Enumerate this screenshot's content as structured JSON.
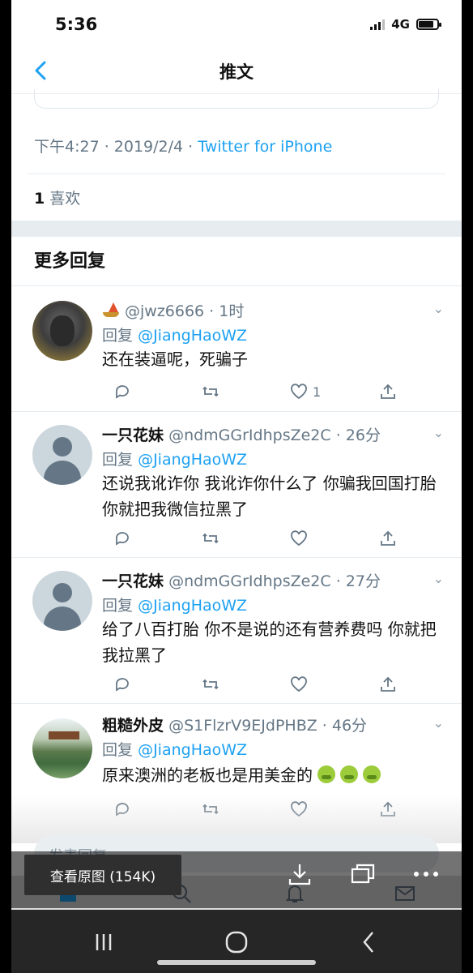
{
  "status_bar": {
    "time": "5:36",
    "network": "4G"
  },
  "nav": {
    "title": "推文"
  },
  "tweet": {
    "meta_prefix": "下午4:27 · 2019/2/4 · ",
    "source": "Twitter for iPhone",
    "likes_count": "1",
    "likes_label": "喜欢"
  },
  "section_title": "更多回复",
  "reply_prefix": "回复",
  "replies": [
    {
      "name": "",
      "handle": "@jwz6666 · 1时",
      "mention": "@JiangHaoWZ",
      "text": "还在装逼呢，死骗子",
      "like_count": "1"
    },
    {
      "name": "一只花妹",
      "handle": "@ndmGGrIdhpsZe2C · 26分",
      "mention": "@JiangHaoWZ",
      "text": "还说我讹诈你 我讹诈你什么了 你骗我回国打胎 你就把我微信拉黑了",
      "like_count": ""
    },
    {
      "name": "一只花妹",
      "handle": "@ndmGGrIdhpsZe2C · 27分",
      "mention": "@JiangHaoWZ",
      "text": "给了八百打胎 你不是说的还有营养费吗 你就把我拉黑了",
      "like_count": ""
    },
    {
      "name": "粗糙外皮",
      "handle": "@S1FlzrV9EJdPHBZ · 46分",
      "mention": "@JiangHaoWZ",
      "text": "原来澳洲的老板也是用美金的",
      "like_count": ""
    }
  ],
  "composer": {
    "placeholder": "发表回复"
  },
  "viewer": {
    "view_original": "查看原图 (154K)"
  }
}
